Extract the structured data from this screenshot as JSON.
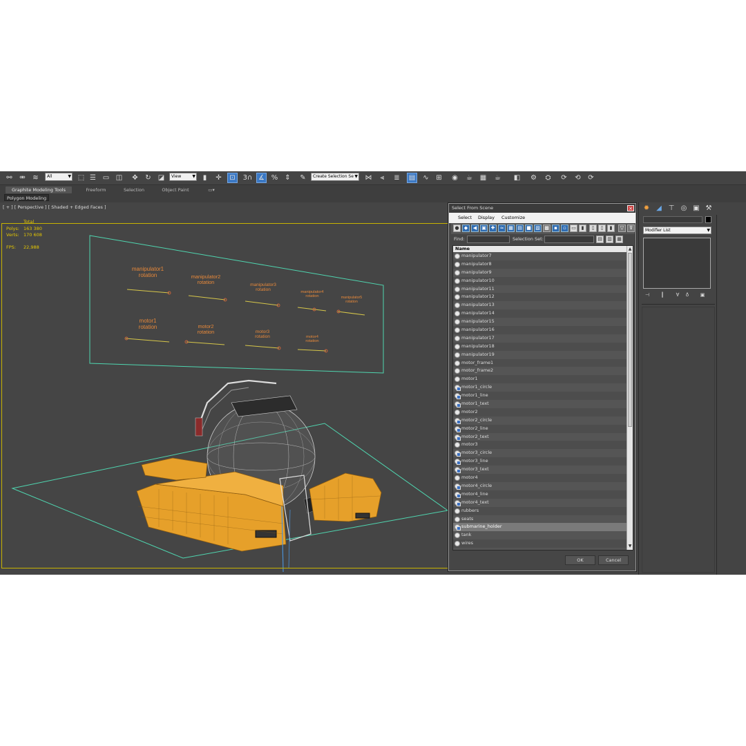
{
  "toolbar": {
    "filter_value": "All",
    "refcoord_value": "View",
    "selection_set_value": "Create Selection Se",
    "snap_label": "3"
  },
  "ribbon": {
    "tabs": [
      "Graphite Modeling Tools",
      "Freeform",
      "Selection",
      "Object Paint"
    ],
    "active_tab": "Graphite Modeling Tools",
    "panel_tab": "Polygon Modeling"
  },
  "viewport": {
    "label": "[ + ] [ Perspective ] [ Shaded + Edged Faces ]",
    "stats": {
      "total_label": "Total",
      "polys_label": "Polys:",
      "polys_value": "163 380",
      "verts_label": "Verts:",
      "verts_value": "170 608",
      "fps_label": "FPS:",
      "fps_value": "22,988"
    },
    "labels": [
      [
        "manipulator1",
        "rotation"
      ],
      [
        "manipulator2",
        "rotation"
      ],
      [
        "manipulator3",
        "rotation"
      ],
      [
        "manipulator4",
        "rotation"
      ],
      [
        "manipulator5",
        "rotation"
      ],
      [
        "motor1",
        "rotation"
      ],
      [
        "motor2",
        "rotation"
      ],
      [
        "motor3",
        "rotation"
      ],
      [
        "motor4",
        "rotation"
      ]
    ],
    "colors": {
      "mesh": "#e6a02a",
      "text": "#e8893a",
      "grid": "#4fd6b0"
    }
  },
  "dialog": {
    "title": "Select From Scene",
    "menu": [
      "Select",
      "Display",
      "Customize"
    ],
    "find_label": "Find:",
    "selection_set_label": "Selection Set:",
    "column_name": "Name",
    "ok_label": "OK",
    "cancel_label": "Cancel",
    "items": [
      {
        "name": "manipulator7",
        "link": false
      },
      {
        "name": "manipulator8",
        "link": false
      },
      {
        "name": "manipulator9",
        "link": false
      },
      {
        "name": "manipulator10",
        "link": false
      },
      {
        "name": "manipulator11",
        "link": false
      },
      {
        "name": "manipulator12",
        "link": false
      },
      {
        "name": "manipulator13",
        "link": false
      },
      {
        "name": "manipulator14",
        "link": false
      },
      {
        "name": "manipulator15",
        "link": false
      },
      {
        "name": "manipulator16",
        "link": false
      },
      {
        "name": "manipulator17",
        "link": false
      },
      {
        "name": "manipulator18",
        "link": false
      },
      {
        "name": "manipulator19",
        "link": false
      },
      {
        "name": "motor_frame1",
        "link": false
      },
      {
        "name": "motor_frame2",
        "link": false
      },
      {
        "name": "motor1",
        "link": false
      },
      {
        "name": "motor1_circle",
        "link": true
      },
      {
        "name": "motor1_line",
        "link": true
      },
      {
        "name": "motor1_text",
        "link": true
      },
      {
        "name": "motor2",
        "link": false
      },
      {
        "name": "motor2_circle",
        "link": true
      },
      {
        "name": "motor2_line",
        "link": true
      },
      {
        "name": "motor2_text",
        "link": true
      },
      {
        "name": "motor3",
        "link": false
      },
      {
        "name": "motor3_circle",
        "link": true
      },
      {
        "name": "motor3_line",
        "link": true
      },
      {
        "name": "motor3_text",
        "link": true
      },
      {
        "name": "motor4",
        "link": false
      },
      {
        "name": "motor4_circle",
        "link": true
      },
      {
        "name": "motor4_line",
        "link": true
      },
      {
        "name": "motor4_text",
        "link": true
      },
      {
        "name": "rubbers",
        "link": false
      },
      {
        "name": "seats",
        "link": false
      },
      {
        "name": "submarine_holder",
        "link": true,
        "selected": true
      },
      {
        "name": "tank",
        "link": false
      },
      {
        "name": "wires",
        "link": false
      }
    ]
  },
  "command_panel": {
    "modifier_list": "Modifier List",
    "swatch_color": "#000000"
  }
}
